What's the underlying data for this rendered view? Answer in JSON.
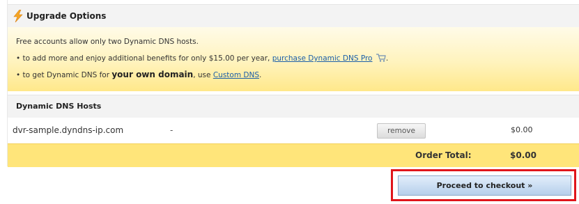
{
  "upgrade": {
    "title": "Upgrade Options",
    "intro": "Free accounts allow only two Dynamic DNS hosts.",
    "line2_prefix": "• to add more and enjoy additional benefits for only $15.00 per year, ",
    "line2_link": "purchase Dynamic DNS Pro",
    "line2_suffix": ".",
    "line3_prefix": "• to get Dynamic DNS for ",
    "line3_bold": "your own domain",
    "line3_middle": ", use ",
    "line3_link": "Custom DNS",
    "line3_suffix": ".",
    "icon": "lightning-bolt-icon"
  },
  "hosts": {
    "title": "Dynamic DNS Hosts",
    "rows": [
      {
        "name": "dvr-sample.dyndns-ip.com",
        "dash": "-",
        "remove_label": "remove",
        "price": "$0.00"
      }
    ]
  },
  "order": {
    "total_label": "Order Total:",
    "total_value": "$0.00"
  },
  "checkout": {
    "label": "Proceed to checkout »"
  },
  "colors": {
    "highlight": "#e0151b",
    "link": "#1a5ea8",
    "yellow": "#ffe57a"
  }
}
